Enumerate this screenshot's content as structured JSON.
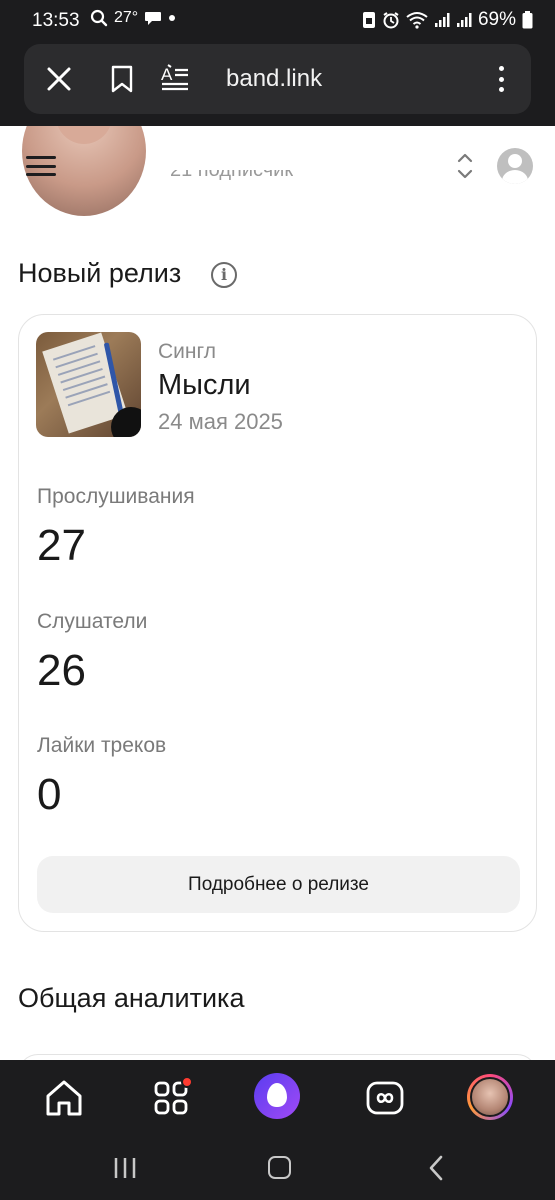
{
  "status_bar": {
    "time": "13:53",
    "temperature": "27°",
    "battery": "69%"
  },
  "browser": {
    "url": "band.link"
  },
  "header_partial": {
    "subscribers_text": "21 подписчик"
  },
  "new_release": {
    "section_title": "Новый релиз",
    "type": "Сингл",
    "title": "Мысли",
    "date": "24 мая 2025",
    "metrics": [
      {
        "label": "Прослушивания",
        "value": "27"
      },
      {
        "label": "Слушатели",
        "value": "26"
      },
      {
        "label": "Лайки треков",
        "value": "0"
      }
    ],
    "details_button": "Подробнее о релизе"
  },
  "analytics": {
    "section_title": "Общая аналитика"
  },
  "app_nav": {
    "items": [
      "home-icon",
      "apps-icon",
      "alice-icon",
      "infinity-icon",
      "profile-avatar"
    ],
    "notification_color": "#ff3b30"
  },
  "colors": {
    "accent_alice": "#7a45f3",
    "background": "#ffffff",
    "chrome": "#1c1c1e"
  }
}
